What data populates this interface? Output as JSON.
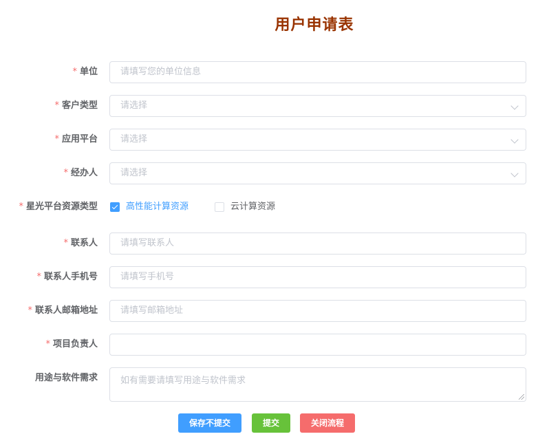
{
  "form": {
    "title": "用户申请表",
    "required_mark": "*",
    "fields": {
      "unit": {
        "label": "单位",
        "placeholder": "请填写您的单位信息"
      },
      "customer_type": {
        "label": "客户类型",
        "placeholder": "请选择"
      },
      "app_platform": {
        "label": "应用平台",
        "placeholder": "请选择"
      },
      "handler": {
        "label": "经办人",
        "placeholder": "请选择"
      },
      "resource_type": {
        "label": "星光平台资源类型",
        "options": [
          {
            "label": "高性能计算资源",
            "checked": true
          },
          {
            "label": "云计算资源",
            "checked": false
          }
        ]
      },
      "contact": {
        "label": "联系人",
        "placeholder": "请填写联系人"
      },
      "contact_phone": {
        "label": "联系人手机号",
        "placeholder": "请填写手机号"
      },
      "contact_email": {
        "label": "联系人邮箱地址",
        "placeholder": "请填写邮箱地址"
      },
      "project_lead": {
        "label": "项目负责人",
        "placeholder": ""
      },
      "usage": {
        "label": "用途与软件需求",
        "placeholder": "如有需要请填写用途与软件需求"
      }
    },
    "buttons": {
      "save": "保存不提交",
      "submit": "提交",
      "close": "关闭流程"
    }
  },
  "colors": {
    "title": "#993300",
    "required": "#f56c6c",
    "primary": "#409eff",
    "success": "#67c23a",
    "danger": "#f56c6c"
  }
}
